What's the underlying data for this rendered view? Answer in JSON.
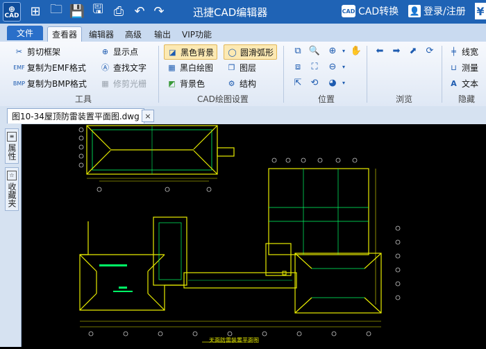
{
  "app": {
    "icon_text": "CAD",
    "title": "迅捷CAD编辑器"
  },
  "titlebar": {
    "cad_convert_badge": "CAD",
    "cad_convert": "CAD转换",
    "login": "登录/注册",
    "yen": "¥"
  },
  "menu": {
    "file": "文件",
    "tabs": [
      "查看器",
      "编辑器",
      "高级",
      "输出",
      "VIP功能"
    ],
    "active": "查看器"
  },
  "ribbon": {
    "tools": {
      "items": [
        "剪切框架",
        "复制为EMF格式",
        "复制为BMP格式",
        "显示点",
        "查找文字",
        "修剪光栅"
      ],
      "label": "工具"
    },
    "cad_settings": {
      "items": [
        "黑色背景",
        "黑白绘图",
        "背景色",
        "圆滑弧形",
        "图层",
        "结构"
      ],
      "label": "CAD绘图设置"
    },
    "position": {
      "label": "位置"
    },
    "browse": {
      "label": "浏览"
    },
    "hide": {
      "items": [
        "线宽",
        "测量",
        "文本"
      ],
      "label": "隐藏"
    }
  },
  "document": {
    "tab": "图10-34屋顶防雷装置平面图.dwg",
    "close": "×"
  },
  "side": {
    "properties": "属性",
    "favorites": "收藏夹"
  },
  "drawing": {
    "title": "天面防雷装置平面图",
    "accent": "#e8ec00",
    "grid_color": "#00ff66"
  }
}
